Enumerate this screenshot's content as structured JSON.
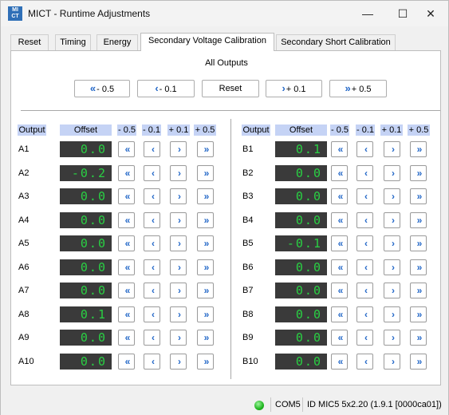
{
  "window": {
    "app_icon_text": "MI\nCT",
    "title": "MICT - Runtime Adjustments",
    "minimize": "—",
    "maximize": "☐",
    "close": "✕"
  },
  "tabs": [
    {
      "label": "Reset",
      "active": false
    },
    {
      "label": "Timing",
      "active": false
    },
    {
      "label": "Energy",
      "active": false
    },
    {
      "label": "Secondary Voltage Calibration",
      "active": true
    },
    {
      "label": "Secondary Short Calibration",
      "active": false
    }
  ],
  "all_outputs": {
    "label": "All Outputs",
    "buttons": {
      "m05": {
        "icon": "double-chevron-left-icon",
        "glyph": "«",
        "label": "- 0.5"
      },
      "m01": {
        "icon": "chevron-left-icon",
        "glyph": "‹",
        "label": "- 0.1"
      },
      "reset": {
        "label": "Reset"
      },
      "p01": {
        "icon": "chevron-right-icon",
        "glyph": "›",
        "label": "+ 0.1"
      },
      "p05": {
        "icon": "double-chevron-right-icon",
        "glyph": "»",
        "label": "+ 0.5"
      }
    }
  },
  "columns": {
    "output": "Output",
    "offset": "Offset",
    "m05": "- 0.5",
    "m01": "- 0.1",
    "p01": "+ 0.1",
    "p05": "+ 0.5"
  },
  "glyphs": {
    "m05": "«",
    "m01": "‹",
    "p01": "›",
    "p05": "»"
  },
  "rows_a": [
    {
      "output": "A1",
      "offset": "0.0"
    },
    {
      "output": "A2",
      "offset": "-0.2"
    },
    {
      "output": "A3",
      "offset": "0.0"
    },
    {
      "output": "A4",
      "offset": "0.0"
    },
    {
      "output": "A5",
      "offset": "0.0"
    },
    {
      "output": "A6",
      "offset": "0.0"
    },
    {
      "output": "A7",
      "offset": "0.0"
    },
    {
      "output": "A8",
      "offset": "0.1"
    },
    {
      "output": "A9",
      "offset": "0.0"
    },
    {
      "output": "A10",
      "offset": "0.0"
    }
  ],
  "rows_b": [
    {
      "output": "B1",
      "offset": "0.1"
    },
    {
      "output": "B2",
      "offset": "0.0"
    },
    {
      "output": "B3",
      "offset": "0.0"
    },
    {
      "output": "B4",
      "offset": "0.0"
    },
    {
      "output": "B5",
      "offset": "-0.1"
    },
    {
      "output": "B6",
      "offset": "0.0"
    },
    {
      "output": "B7",
      "offset": "0.0"
    },
    {
      "output": "B8",
      "offset": "0.0"
    },
    {
      "output": "B9",
      "offset": "0.0"
    },
    {
      "output": "B10",
      "offset": "0.0"
    }
  ],
  "status": {
    "connection_color": "#1fb51f",
    "port": "COM5",
    "device": "ID MIC5 5x2.20 (1.9.1 [0000ca01])"
  },
  "colors": {
    "display_bg": "#3a3a3a",
    "display_fg": "#29d043",
    "header_bg": "#c5d3f5",
    "arrow": "#2468c8"
  }
}
